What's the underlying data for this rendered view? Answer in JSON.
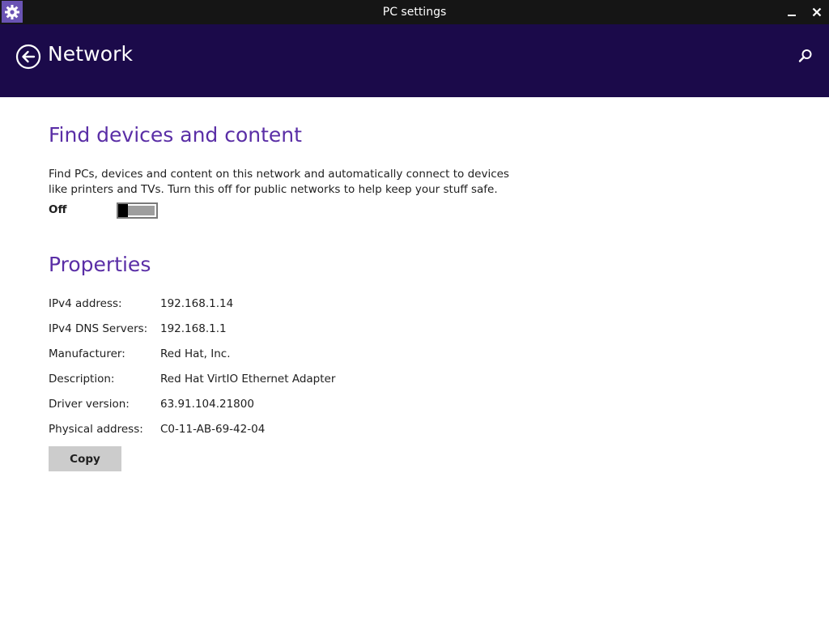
{
  "window": {
    "title": "PC settings",
    "app_icon": "gear-icon",
    "controls": [
      "minimize-icon",
      "close-icon"
    ],
    "accent_color": "#6a54b4",
    "titlebar_color": "#151515"
  },
  "header": {
    "title": "Network",
    "back_icon": "back-arrow-icon",
    "search_icon": "search-icon",
    "background_color": "#1b0a4a"
  },
  "find_devices": {
    "title": "Find devices and content",
    "description": "Find PCs, devices and content on this network and automatically connect to devices like printers and TVs. Turn this off for public networks to help keep your stuff safe.",
    "toggle_state_label": "Off",
    "toggle_on": false,
    "title_color": "#5a2ea6"
  },
  "properties": {
    "title": "Properties",
    "rows": [
      {
        "label": "IPv4 address:",
        "value": "192.168.1.14"
      },
      {
        "label": "IPv4 DNS Servers:",
        "value": "192.168.1.1"
      },
      {
        "label": "Manufacturer:",
        "value": "Red Hat, Inc."
      },
      {
        "label": "Description:",
        "value": "Red Hat VirtIO Ethernet Adapter"
      },
      {
        "label": "Driver version:",
        "value": "63.91.104.21800"
      },
      {
        "label": "Physical address:",
        "value": "C0-11-AB-69-42-04"
      }
    ],
    "copy_label": "Copy"
  }
}
